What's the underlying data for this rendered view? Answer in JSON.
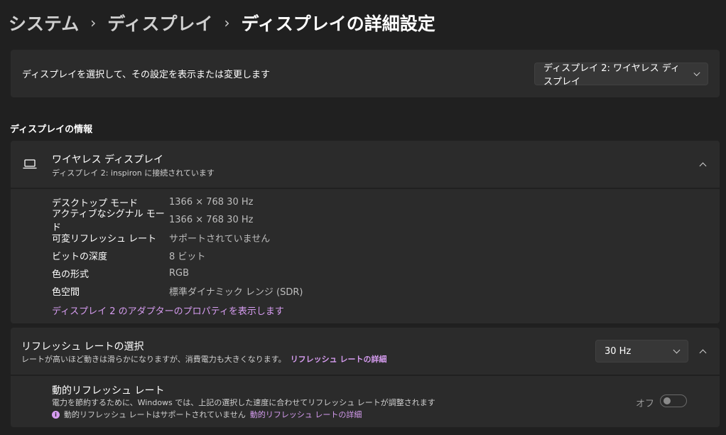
{
  "breadcrumb": {
    "items": [
      "システム",
      "ディスプレイ",
      "ディスプレイの詳細設定"
    ],
    "separator": "›"
  },
  "display_select": {
    "description": "ディスプレイを選択して、その設定を表示または変更します",
    "selected": "ディスプレイ 2: ワイヤレス ディスプレイ"
  },
  "display_info": {
    "section_title": "ディスプレイの情報",
    "title": "ワイヤレス ディスプレイ",
    "subtitle": "ディスプレイ 2: inspiron に接続されています",
    "expanded": true,
    "rows": [
      {
        "label": "デスクトップ モード",
        "value": "1366 × 768 30 Hz"
      },
      {
        "label": "アクティブなシグナル モード",
        "value": "1366 × 768 30 Hz"
      },
      {
        "label": "可変リフレッシュ レート",
        "value": "サポートされていません"
      },
      {
        "label": "ビットの深度",
        "value": "8 ビット"
      },
      {
        "label": "色の形式",
        "value": "RGB"
      },
      {
        "label": "色空間",
        "value": "標準ダイナミック レンジ (SDR)"
      }
    ],
    "adapter_link": "ディスプレイ 2 のアダプターのプロパティを表示します"
  },
  "refresh": {
    "title": "リフレッシュ レートの選択",
    "subtitle": "レートが高いほど動きは滑らかになりますが、消費電力も大きくなります。",
    "details_link": "リフレッシュ レートの詳細",
    "selected_rate": "30 Hz",
    "expanded": true
  },
  "dynamic_refresh": {
    "title": "動的リフレッシュ レート",
    "description": "電力を節約するために、Windows では、上記の選択した速度に合わせてリフレッシュ レートが調整されます",
    "note_icon": "info-icon",
    "note": "動的リフレッシュ レートはサポートされていません",
    "note_link": "動的リフレッシュ レートの詳細",
    "toggle_label": "オフ",
    "toggle_on": false
  },
  "colors": {
    "background": "#202020",
    "card": "#2b2b2b",
    "accent_link": "#d69cf0"
  }
}
